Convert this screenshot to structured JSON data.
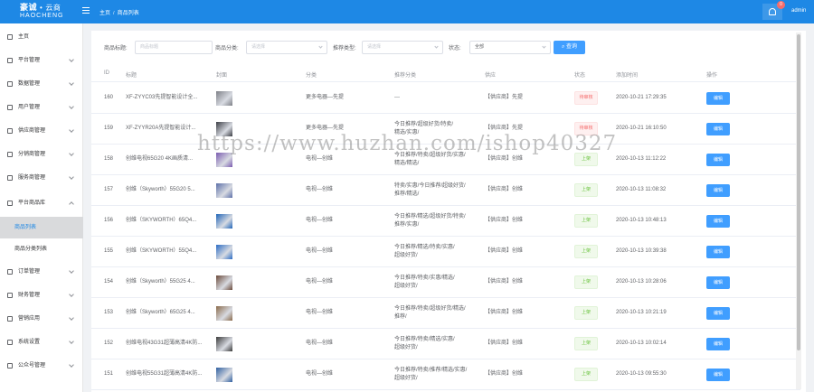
{
  "header": {
    "logo_main": "豪诚",
    "logo_dot": "•",
    "logo_sub": "云商",
    "logo_en": "HAOCHENG",
    "breadcrumb": [
      "主页",
      "商品列表"
    ],
    "breadcrumb_sep": "/",
    "notification_count": "0",
    "user": "admin",
    "colors": {
      "topbar": "#1e88e5",
      "badge": "#f56c6c"
    }
  },
  "sidebar": {
    "items": [
      {
        "label": "主页",
        "icon": "home-icon"
      },
      {
        "label": "平台管理",
        "icon": "platform-icon"
      },
      {
        "label": "数据管理",
        "icon": "chart-icon"
      },
      {
        "label": "用户管理",
        "icon": "user-icon"
      },
      {
        "label": "供应商管理",
        "icon": "supplier-icon"
      },
      {
        "label": "分销商管理",
        "icon": "distributor-icon"
      },
      {
        "label": "服务商管理",
        "icon": "service-icon"
      },
      {
        "label": "平台商品库",
        "icon": "goods-icon"
      },
      {
        "label": "订单管理",
        "icon": "order-icon"
      },
      {
        "label": "财务管理",
        "icon": "finance-icon"
      },
      {
        "label": "营销应用",
        "icon": "marketing-icon"
      },
      {
        "label": "系统设置",
        "icon": "settings-icon"
      },
      {
        "label": "公众号管理",
        "icon": "wechat-icon"
      }
    ],
    "sub_items": [
      {
        "label": "商品列表",
        "active": true
      },
      {
        "label": "商品分类列表",
        "active": false
      }
    ]
  },
  "filters": {
    "title_label": "商品标题:",
    "title_placeholder": "商品标题",
    "category_label": "商品分类:",
    "category_placeholder": "请选择",
    "recommend_label": "推荐类型:",
    "recommend_placeholder": "请选择",
    "status_label": "状态:",
    "status_value": "全部",
    "search_button": "查询"
  },
  "table": {
    "columns": [
      "ID",
      "标题",
      "封面",
      "分类",
      "推荐分类",
      "供应",
      "状态",
      "添加时间",
      "操作"
    ],
    "rows": [
      {
        "id": "160",
        "title": "XF-ZYYC03先提智能设计全...",
        "category": "更多电器—先提",
        "recommend": [
          "---"
        ],
        "supplier": "【供应商】先提",
        "status": "待审核",
        "status_type": "off",
        "time": "2020-10-21 17:29:35",
        "action": "编辑",
        "cover_color": "#7d7f86"
      },
      {
        "id": "159",
        "title": "XF-ZYYR20A先提智能设计...",
        "category": "更多电器—先提",
        "recommend": [
          "今日推荐/超级好货/特卖/",
          "精选/实惠/"
        ],
        "supplier": "【供应商】先提",
        "status": "待审核",
        "status_type": "off",
        "time": "2020-10-21 16:10:50",
        "action": "编辑",
        "cover_color": "#3b3d44"
      },
      {
        "id": "158",
        "title": "创维电视65G20 4K画质清...",
        "category": "电视—创维",
        "recommend": [
          "今日推荐/特卖/超级好货/实惠/",
          "精选/精选/"
        ],
        "supplier": "【供应商】创维",
        "status": "上架",
        "status_type": "on",
        "time": "2020-10-13 11:12:22",
        "action": "编辑",
        "cover_color": "#7a5bb0"
      },
      {
        "id": "157",
        "title": "创维（Skyworth）55G20 5...",
        "category": "电视—创维",
        "recommend": [
          "特卖/实惠/今日推荐/超级好货/",
          "推荐/精选/"
        ],
        "supplier": "【供应商】创维",
        "status": "上架",
        "status_type": "on",
        "time": "2020-10-13 11:08:32",
        "action": "编辑",
        "cover_color": "#5c6fa8"
      },
      {
        "id": "156",
        "title": "创维（SKYWORTH）65Q4...",
        "category": "电视—创维",
        "recommend": [
          "今日推荐/精选/超级好货/特卖/",
          "推荐/实惠/"
        ],
        "supplier": "【供应商】创维",
        "status": "上架",
        "status_type": "on",
        "time": "2020-10-13 10:48:13",
        "action": "编辑",
        "cover_color": "#1f64b8"
      },
      {
        "id": "155",
        "title": "创维（SKYWORTH）55Q4...",
        "category": "电视—创维",
        "recommend": [
          "今日推荐/精选/特卖/实惠/",
          "超级好货/"
        ],
        "supplier": "【供应商】创维",
        "status": "上架",
        "status_type": "on",
        "time": "2020-10-13 10:39:38",
        "action": "编辑",
        "cover_color": "#2b6cc4"
      },
      {
        "id": "154",
        "title": "创维（Skyworth）55G25 4...",
        "category": "电视—创维",
        "recommend": [
          "今日推荐/特卖/实惠/精选/",
          "超级好货/"
        ],
        "supplier": "【供应商】创维",
        "status": "上架",
        "status_type": "on",
        "time": "2020-10-13 10:28:06",
        "action": "编辑",
        "cover_color": "#6b4a3a"
      },
      {
        "id": "153",
        "title": "创维（Skyworth）65G25 4...",
        "category": "电视—创维",
        "recommend": [
          "今日推荐/特卖/超级好货/精选/",
          "推荐/"
        ],
        "supplier": "【供应商】创维",
        "status": "上架",
        "status_type": "on",
        "time": "2020-10-13 10:21:19",
        "action": "编辑",
        "cover_color": "#8a6a4a"
      },
      {
        "id": "152",
        "title": "创维电视43G31超薄高清4K防...",
        "category": "电视—创维",
        "recommend": [
          "今日推荐/特卖/精选/实惠/",
          "超级好货/"
        ],
        "supplier": "【供应商】创维",
        "status": "上架",
        "status_type": "on",
        "time": "2020-10-13 10:02:14",
        "action": "编辑",
        "cover_color": "#3a3a3a"
      },
      {
        "id": "151",
        "title": "创维电视55G31超薄高清4K防...",
        "category": "电视—创维",
        "recommend": [
          "今日推荐/特卖/推荐/精选/实惠/",
          "超级好货/"
        ],
        "supplier": "【供应商】创维",
        "status": "上架",
        "status_type": "on",
        "time": "2020-10-13 09:55:30",
        "action": "编辑",
        "cover_color": "#2f5fa0"
      }
    ]
  },
  "watermark": "https://www.huzhan.com/ishop40327"
}
